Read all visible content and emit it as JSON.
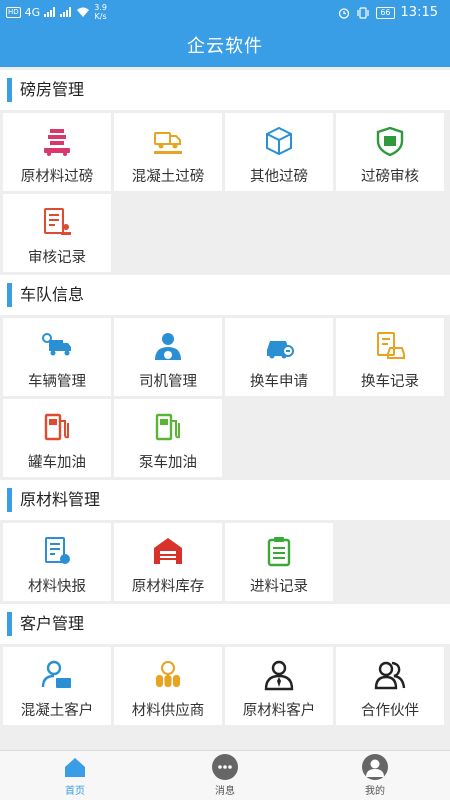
{
  "status_bar": {
    "network_left": "4G",
    "net_speed_value": "3.9",
    "net_speed_unit": "K/s",
    "battery": "66",
    "time": "13:15"
  },
  "app_title": "企云软件",
  "sections": [
    {
      "title": "磅房管理",
      "items": [
        {
          "label": "原材料过磅",
          "icon": "scale-stack-icon",
          "color": "#d9386b"
        },
        {
          "label": "混凝土过磅",
          "icon": "truck-scale-icon",
          "color": "#e8a321"
        },
        {
          "label": "其他过磅",
          "icon": "box-icon",
          "color": "#2a8fd3"
        },
        {
          "label": "过磅审核",
          "icon": "shield-check-icon",
          "color": "#2e9a3b"
        },
        {
          "label": "审核记录",
          "icon": "document-stamp-icon",
          "color": "#e04a2e"
        }
      ]
    },
    {
      "title": "车队信息",
      "items": [
        {
          "label": "车辆管理",
          "icon": "truck-gear-icon",
          "color": "#2a8fd3"
        },
        {
          "label": "司机管理",
          "icon": "driver-icon",
          "color": "#2a8fd3"
        },
        {
          "label": "换车申请",
          "icon": "car-swap-icon",
          "color": "#2a8fd3"
        },
        {
          "label": "换车记录",
          "icon": "car-record-icon",
          "color": "#e8a321"
        },
        {
          "label": "罐车加油",
          "icon": "fuel-pump-icon",
          "color": "#e04a2e"
        },
        {
          "label": "泵车加油",
          "icon": "fuel-pump-icon",
          "color": "#5ab534"
        }
      ]
    },
    {
      "title": "原材料管理",
      "items": [
        {
          "label": "材料快报",
          "icon": "report-icon",
          "color": "#2a8fd3"
        },
        {
          "label": "原材料库存",
          "icon": "warehouse-icon",
          "color": "#d8322a"
        },
        {
          "label": "进料记录",
          "icon": "clipboard-icon",
          "color": "#3aa835"
        }
      ]
    },
    {
      "title": "客户管理",
      "items": [
        {
          "label": "混凝土客户",
          "icon": "customer-card-icon",
          "color": "#2a8fd3"
        },
        {
          "label": "材料供应商",
          "icon": "supplier-icon",
          "color": "#e8a321"
        },
        {
          "label": "原材料客户",
          "icon": "businessman-icon",
          "color": "#222222"
        },
        {
          "label": "合作伙伴",
          "icon": "partners-icon",
          "color": "#222222"
        }
      ]
    }
  ],
  "tabbar": [
    {
      "label": "首页",
      "icon": "home-icon",
      "active": true
    },
    {
      "label": "消息",
      "icon": "message-icon",
      "active": false
    },
    {
      "label": "我的",
      "icon": "profile-icon",
      "active": false
    }
  ],
  "colors": {
    "primary": "#3a9ee6",
    "background": "#eeeeee"
  }
}
